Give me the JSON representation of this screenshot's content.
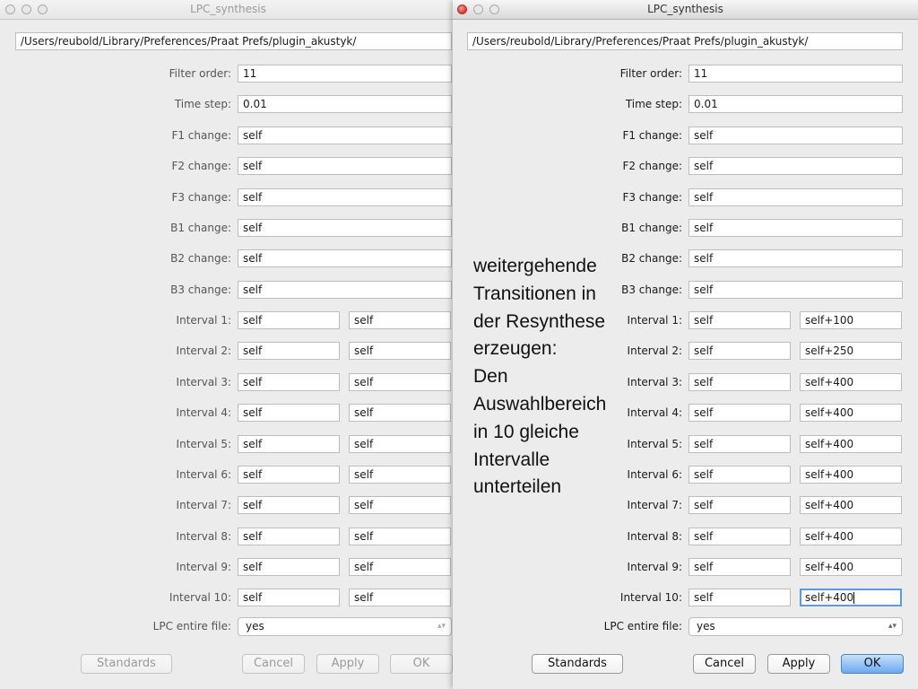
{
  "windows": [
    {
      "title": "LPC_synthesis",
      "path": "/Users/reubold/Library/Preferences/Praat Prefs/plugin_akustyk/",
      "filter_order_label": "Filter order:",
      "filter_order": "11",
      "time_step_label": "Time step:",
      "time_step": "0.01",
      "changes": [
        {
          "label": "F1 change:",
          "value": "self"
        },
        {
          "label": "F2 change:",
          "value": "self"
        },
        {
          "label": "F3 change:",
          "value": "self"
        },
        {
          "label": "B1 change:",
          "value": "self"
        },
        {
          "label": "B2 change:",
          "value": "self"
        },
        {
          "label": "B3 change:",
          "value": "self"
        }
      ],
      "intervals": [
        {
          "label": "Interval 1:",
          "a": "self",
          "b": "self"
        },
        {
          "label": "Interval 2:",
          "a": "self",
          "b": "self"
        },
        {
          "label": "Interval 3:",
          "a": "self",
          "b": "self"
        },
        {
          "label": "Interval 4:",
          "a": "self",
          "b": "self"
        },
        {
          "label": "Interval 5:",
          "a": "self",
          "b": "self"
        },
        {
          "label": "Interval 6:",
          "a": "self",
          "b": "self"
        },
        {
          "label": "Interval 7:",
          "a": "self",
          "b": "self"
        },
        {
          "label": "Interval 8:",
          "a": "self",
          "b": "self"
        },
        {
          "label": "Interval 9:",
          "a": "self",
          "b": "self"
        },
        {
          "label": "Interval 10:",
          "a": "self",
          "b": "self"
        }
      ],
      "lpc_label": "LPC entire file:",
      "lpc_value": "yes",
      "buttons": {
        "standards": "Standards",
        "cancel": "Cancel",
        "apply": "Apply",
        "ok": "OK"
      }
    },
    {
      "title": "LPC_synthesis",
      "path": "/Users/reubold/Library/Preferences/Praat Prefs/plugin_akustyk/",
      "filter_order_label": "Filter order:",
      "filter_order": "11",
      "time_step_label": "Time step:",
      "time_step": "0.01",
      "changes": [
        {
          "label": "F1 change:",
          "value": "self"
        },
        {
          "label": "F2 change:",
          "value": "self"
        },
        {
          "label": "F3 change:",
          "value": "self"
        },
        {
          "label": "B1 change:",
          "value": "self"
        },
        {
          "label": "B2 change:",
          "value": "self"
        },
        {
          "label": "B3 change:",
          "value": "self"
        }
      ],
      "intervals": [
        {
          "label": "Interval 1:",
          "a": "self",
          "b": "self+100"
        },
        {
          "label": "Interval 2:",
          "a": "self",
          "b": "self+250"
        },
        {
          "label": "Interval 3:",
          "a": "self",
          "b": "self+400"
        },
        {
          "label": "Interval 4:",
          "a": "self",
          "b": "self+400"
        },
        {
          "label": "Interval 5:",
          "a": "self",
          "b": "self+400"
        },
        {
          "label": "Interval 6:",
          "a": "self",
          "b": "self+400"
        },
        {
          "label": "Interval 7:",
          "a": "self",
          "b": "self+400"
        },
        {
          "label": "Interval 8:",
          "a": "self",
          "b": "self+400"
        },
        {
          "label": "Interval 9:",
          "a": "self",
          "b": "self+400"
        },
        {
          "label": "Interval 10:",
          "a": "self",
          "b": "self+400"
        }
      ],
      "lpc_label": "LPC entire file:",
      "lpc_value": "yes",
      "buttons": {
        "standards": "Standards",
        "cancel": "Cancel",
        "apply": "Apply",
        "ok": "OK"
      }
    }
  ],
  "annotation": {
    "lines": [
      "weitergehende",
      "Transitionen in",
      "der Resynthese",
      "erzeugen:",
      "Den",
      "Auswahlbereich",
      "in 10 gleiche",
      "Intervalle",
      "unterteilen"
    ]
  }
}
